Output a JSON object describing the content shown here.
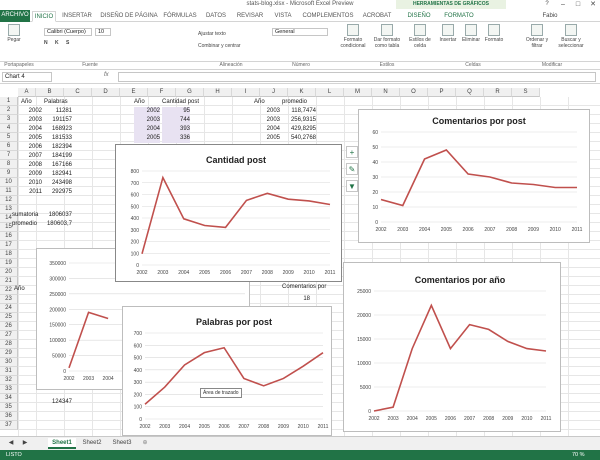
{
  "window": {
    "title": "stats-blog.xlsx - Microsoft Excel Preview",
    "contextual_tab_group": "HERRAMIENTAS DE GRÁFICOS",
    "user": "Fabio",
    "help": "?",
    "min": "–",
    "max": "□",
    "close": "✕"
  },
  "tabs": [
    "ARCHIVO",
    "INICIO",
    "INSERTAR",
    "DISEÑO DE PÁGINA",
    "FÓRMULAS",
    "DATOS",
    "REVISAR",
    "VISTA",
    "COMPLEMENTOS",
    "ACROBAT",
    "DISEÑO",
    "FORMATO"
  ],
  "ribbon": {
    "paste": "Pegar",
    "font_name": "Calibri (Cuerpo)",
    "font_size": "10",
    "wrap": "Ajustar texto",
    "merge": "Combinar y centrar",
    "number_format": "General",
    "cond_format": "Formato condicional",
    "table_format": "Dar formato como tabla",
    "cell_styles": "Estilos de celda",
    "insert": "Insertar",
    "delete": "Eliminar",
    "format": "Formato",
    "sort": "Ordenar y filtrar",
    "find": "Buscar y seleccionar",
    "group_clipboard": "Portapapeles",
    "group_font": "Fuente",
    "group_align": "Alineación",
    "group_number": "Número",
    "group_styles": "Estilos",
    "group_cells": "Celdas",
    "group_edit": "Modificar"
  },
  "formula_bar": {
    "name_box": "Chart 4",
    "fx": "fx"
  },
  "columns": [
    "A",
    "B",
    "C",
    "D",
    "E",
    "F",
    "G",
    "H",
    "I",
    "J",
    "K",
    "L",
    "M",
    "N",
    "O",
    "P",
    "Q",
    "R",
    "S"
  ],
  "rows": [
    "1",
    "2",
    "3",
    "4",
    "5",
    "6",
    "7",
    "8",
    "9",
    "10",
    "11",
    "12",
    "13",
    "14",
    "15",
    "16",
    "17",
    "18",
    "19",
    "20",
    "21",
    "22",
    "23",
    "24",
    "25",
    "26",
    "27",
    "28",
    "29",
    "30",
    "31",
    "32",
    "33",
    "34",
    "35",
    "36",
    "37"
  ],
  "cells": {
    "a1": "Año",
    "b1": "Palabras",
    "e1": "Año",
    "f1": "Cantidad post",
    "i1": "Año",
    "j1": "promedio",
    "a_years": [
      "2002",
      "2003",
      "2004",
      "2005",
      "2006",
      "2007",
      "2008",
      "2009",
      "2010",
      "2011"
    ],
    "b_vals": [
      "11281",
      "191157",
      "168923",
      "181533",
      "182394",
      "184199",
      "167166",
      "182941",
      "243498",
      "292975"
    ],
    "e_years": [
      "2002",
      "2003",
      "2004",
      "2005"
    ],
    "f_vals": [
      "95",
      "744",
      "393",
      "336"
    ],
    "i_years": [
      "2003",
      "2003",
      "2004",
      "2005"
    ],
    "j_vals": [
      "118,7474",
      "256,9315",
      "429,8295",
      "540,2768"
    ],
    "sum_label": "sumatoria",
    "sum_val": "1806037",
    "avg_label": "promedio",
    "avg_val": "180603,7",
    "a20": "Año",
    "i20": "Comentarios por",
    "a33_val": "124347",
    "j21": "18"
  },
  "charts": {
    "cantidad": {
      "title": "Cantidad post",
      "categories": [
        "2002",
        "2003",
        "2004",
        "2005",
        "2006",
        "2007",
        "2008",
        "2009",
        "2010",
        "2011"
      ],
      "values": [
        95,
        744,
        393,
        336,
        320,
        550,
        610,
        560,
        545,
        515
      ],
      "ylim": [
        0,
        800
      ],
      "yticks": [
        0,
        100,
        200,
        300,
        400,
        500,
        600,
        700,
        800
      ]
    },
    "comentarios_post": {
      "title": "Comentarios por post",
      "categories": [
        "2002",
        "2003",
        "2004",
        "2005",
        "2006",
        "2007",
        "2008",
        "2009",
        "2010",
        "2011"
      ],
      "values": [
        15,
        11,
        42,
        48,
        32,
        30,
        26,
        25,
        23,
        23
      ],
      "ylim": [
        0,
        60
      ],
      "yticks": [
        0,
        10,
        20,
        30,
        40,
        50,
        60
      ]
    },
    "comentarios_anio": {
      "title": "Comentarios por año",
      "categories": [
        "2002",
        "2003",
        "2004",
        "2005",
        "2006",
        "2007",
        "2008",
        "2009",
        "2010",
        "2011"
      ],
      "values": [
        0,
        800,
        13000,
        22000,
        13000,
        18000,
        17000,
        14500,
        13000,
        12500
      ],
      "ylim": [
        0,
        25000
      ],
      "yticks": [
        0,
        5000,
        10000,
        15000,
        20000,
        25000
      ]
    },
    "palabras_post": {
      "title": "Palabras por post",
      "categories": [
        "2002",
        "2003",
        "2004",
        "2005",
        "2006",
        "2007",
        "2008",
        "2009",
        "2010",
        "2011"
      ],
      "values": [
        120,
        260,
        440,
        540,
        580,
        330,
        270,
        330,
        430,
        540
      ],
      "ylim": [
        0,
        700
      ],
      "yticks": [
        0,
        100,
        200,
        300,
        400,
        500,
        600,
        700
      ]
    },
    "palabras_bg": {
      "categories": [
        "2002",
        "2003",
        "2004"
      ],
      "values": [
        10000,
        190000,
        170000
      ],
      "ylim": [
        0,
        350000
      ],
      "yticks": [
        0,
        50000,
        100000,
        150000,
        200000,
        250000,
        300000,
        350000
      ]
    },
    "tooltip": "Área de trazado"
  },
  "sheets": [
    "Sheet1",
    "Sheet2",
    "Sheet3"
  ],
  "status": {
    "ready": "LISTO",
    "zoom": "70 %"
  },
  "colors": {
    "accent": "#217346",
    "line": "#c0504d"
  }
}
